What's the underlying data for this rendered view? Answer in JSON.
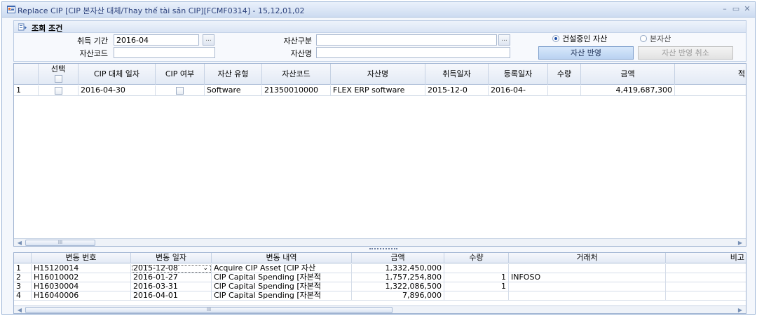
{
  "window": {
    "title": "Replace CIP [CIP 본자산 대체/Thay thế tài sản CIP][FCMF0314] - 15,12,01,02",
    "buttons": {
      "minimize": "–",
      "restore": "▭",
      "close": "✕"
    }
  },
  "conditions": {
    "section_title": "조회 조건",
    "period_label": "취득 기간",
    "period_value": "2016-04",
    "asset_code_label": "자산코드",
    "asset_code_value": "",
    "asset_type_label": "자산구분",
    "asset_type_value": "",
    "asset_name_label": "자산명",
    "asset_name_value": "",
    "ellipsis": "...",
    "radio_construction": "건설중인 자산",
    "radio_main": "본자산",
    "selected_radio": "건설중인 자산",
    "apply_button": "자산 반영",
    "cancel_button": "자산 반영 취소"
  },
  "upper_grid": {
    "headers": {
      "select": "선택",
      "cip_date": "CIP 대체 일자",
      "cip_yn": "CIP 여부",
      "asset_type": "자산 유형",
      "asset_code": "자산코드",
      "asset_name": "자산명",
      "acq_date": "취득일자",
      "reg_date": "등록일자",
      "qty": "수량",
      "amount": "금액",
      "extra": "적"
    },
    "rows": [
      {
        "no": "1",
        "cip_date": "2016-04-30",
        "asset_type": "Software",
        "asset_code": "21350010000",
        "asset_name": "FLEX ERP software",
        "acq_date": "2015-12-0",
        "reg_date": "2016-04-",
        "qty": "",
        "amount": "4,419,687,300"
      }
    ],
    "scroll_thumb": "III"
  },
  "lower_grid": {
    "headers": {
      "change_no": "변동 번호",
      "change_date": "변동 일자",
      "change_desc": "변동 내역",
      "amount": "금액",
      "qty": "수량",
      "vendor": "거래처",
      "note": "비고"
    },
    "rows": [
      {
        "no": "1",
        "change_no": "H15120014",
        "change_date": "2015-12-08",
        "change_desc": "Acquire CIP Asset [CIP 자산",
        "amount": "1,332,450,000",
        "qty": "",
        "vendor": ""
      },
      {
        "no": "2",
        "change_no": "H16010002",
        "change_date": "2016-01-27",
        "change_desc": "CIP Capital Spending [자본적",
        "amount": "1,757,254,800",
        "qty": "1",
        "vendor": "INFOSO"
      },
      {
        "no": "3",
        "change_no": "H16030004",
        "change_date": "2016-03-31",
        "change_desc": "CIP Capital Spending [자본적",
        "amount": "1,322,086,500",
        "qty": "1",
        "vendor": ""
      },
      {
        "no": "4",
        "change_no": "H16040006",
        "change_date": "2016-04-01",
        "change_desc": "CIP Capital Spending [자본적",
        "amount": "7,896,000",
        "qty": "",
        "vendor": ""
      }
    ],
    "dropdown_glyph": "⌄",
    "scroll_thumb": "III"
  }
}
